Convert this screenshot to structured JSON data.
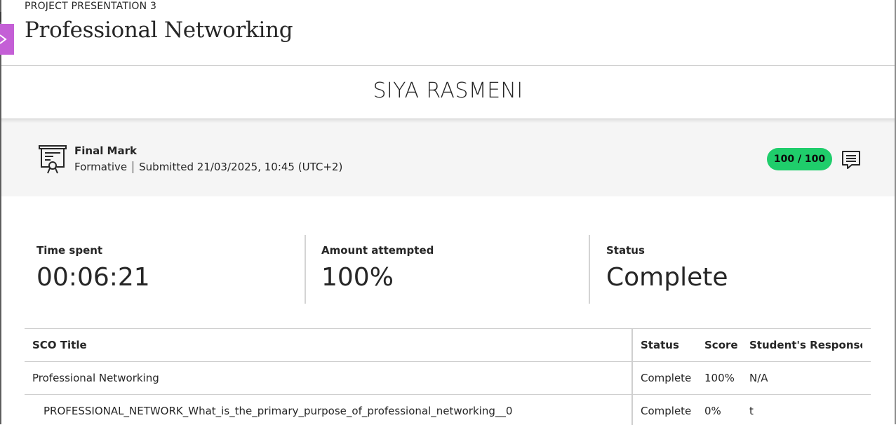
{
  "header": {
    "eyebrow": "PROJECT PRESENTATION 3",
    "title": "Professional Networking"
  },
  "student": {
    "name": "SIYA RASMENI"
  },
  "grade": {
    "title": "Final Mark",
    "type": "Formative",
    "submitted": "Submitted 21/03/2025, 10:45 (UTC+2)",
    "score": "100 / 100",
    "score_color": "#1fcd6b"
  },
  "stats": [
    {
      "label": "Time spent",
      "value": "00:06:21"
    },
    {
      "label": "Amount attempted",
      "value": "100%"
    },
    {
      "label": "Status",
      "value": "Complete"
    }
  ],
  "table": {
    "headers": [
      "SCO Title",
      "Status",
      "Score",
      "Student's Response"
    ],
    "rows": [
      {
        "title": "Professional Networking",
        "status": "Complete",
        "score": "100%",
        "response": "N/A"
      },
      {
        "title": "PROFESSIONAL_NETWORK_What_is_the_primary_purpose_of_professional_networking__0",
        "status": "Complete",
        "score": "0%",
        "response": "t"
      }
    ]
  },
  "icons": {
    "close": "close-icon",
    "certificate": "certificate-icon",
    "feedback": "feedback-comment-icon"
  },
  "colors": {
    "accent_tab": "#c45fd6",
    "score_pill": "#1fcd6b"
  }
}
